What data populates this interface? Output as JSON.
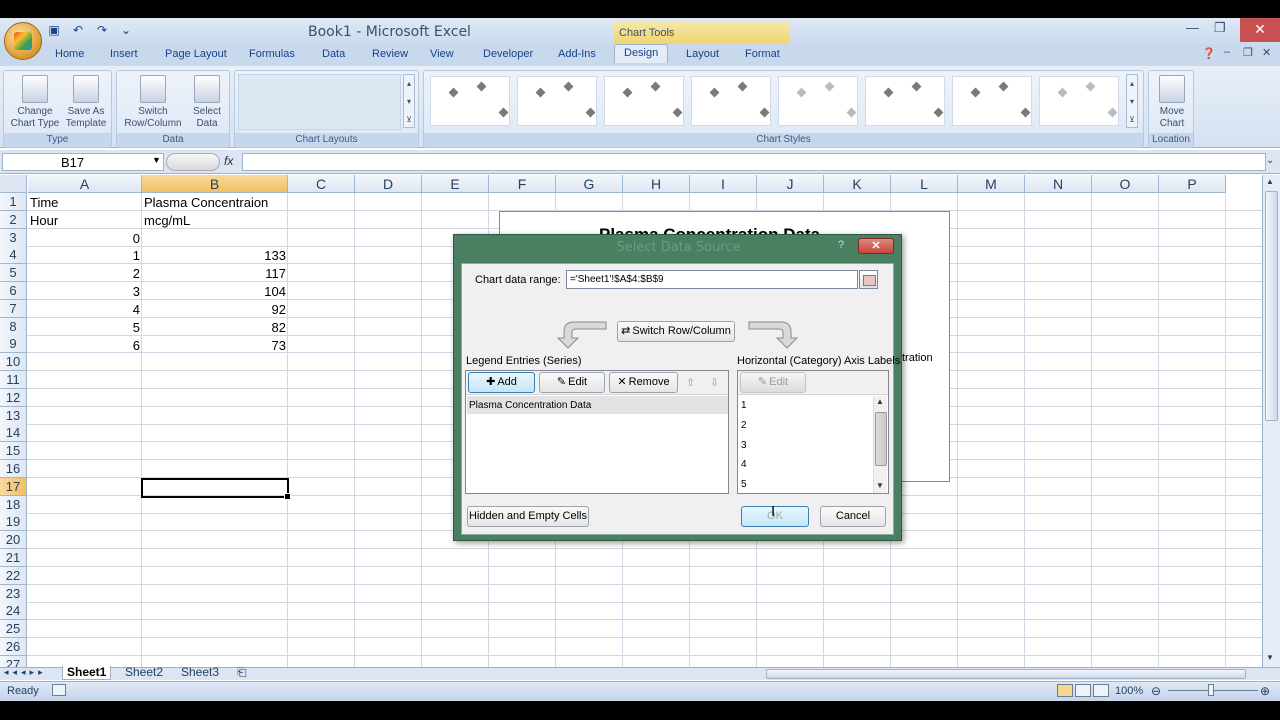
{
  "window": {
    "title": "Book1 - Microsoft Excel",
    "contextual_group": "Chart Tools"
  },
  "ribbon": {
    "tabs": [
      {
        "label": "Home"
      },
      {
        "label": "Insert"
      },
      {
        "label": "Page Layout"
      },
      {
        "label": "Formulas"
      },
      {
        "label": "Data"
      },
      {
        "label": "Review"
      },
      {
        "label": "View"
      },
      {
        "label": "Developer"
      },
      {
        "label": "Add-Ins"
      },
      {
        "label": "Design"
      },
      {
        "label": "Layout"
      },
      {
        "label": "Format"
      }
    ],
    "active_tab": "Design",
    "groups": {
      "type": {
        "label": "Type",
        "change_chart_type": "Change Chart Type",
        "save_as_template": "Save As Template"
      },
      "data": {
        "label": "Data",
        "switch_row_column": "Switch Row/Column",
        "select_data": "Select Data"
      },
      "chart_layouts": {
        "label": "Chart Layouts"
      },
      "chart_styles": {
        "label": "Chart Styles"
      },
      "location": {
        "label": "Location",
        "move_chart": "Move Chart"
      }
    }
  },
  "formula_bar": {
    "name_box": "B17",
    "fx": "fx",
    "formula": ""
  },
  "grid": {
    "columns": [
      "A",
      "B",
      "C",
      "D",
      "E",
      "F",
      "G",
      "H",
      "I",
      "J",
      "K",
      "L",
      "M",
      "N",
      "O",
      "P"
    ],
    "rows": [
      "1",
      "2",
      "3",
      "4",
      "5",
      "6",
      "7",
      "8",
      "9",
      "10",
      "11",
      "12",
      "13",
      "14",
      "15",
      "16",
      "17",
      "18",
      "19",
      "20",
      "21",
      "22",
      "23",
      "24",
      "25",
      "26",
      "27"
    ],
    "cells": {
      "A1": "Time",
      "B1": "Plasma Concentraion",
      "A2": "Hour",
      "B2": "mcg/mL",
      "A3": "0",
      "A4": "1",
      "B4": "133",
      "A5": "2",
      "B5": "117",
      "A6": "3",
      "B6": "104",
      "A7": "4",
      "B7": "92",
      "A8": "5",
      "B8": "82",
      "A9": "6",
      "B9": "73"
    },
    "selected_cell": "B17"
  },
  "chart": {
    "title": "Plasma Concentration Data",
    "legend_fragment": "tration"
  },
  "dialog": {
    "title": "Select Data Source",
    "help": "?",
    "close": "✕",
    "chart_data_range_label": "Chart data range:",
    "chart_data_range_value": "='Sheet1'!$A$4:$B$9",
    "switch_row_column": "Switch Row/Column",
    "legend_entries_label": "Legend Entries (Series)",
    "legend_buttons": {
      "add": "Add",
      "edit": "Edit",
      "remove": "Remove"
    },
    "series": [
      "Plasma Concentration Data"
    ],
    "axis_labels_label": "Horizontal (Category) Axis Labels",
    "axis_edit": "Edit",
    "axis_labels": [
      "1",
      "2",
      "3",
      "4",
      "5"
    ],
    "hidden_empty_cells": "Hidden and Empty Cells",
    "ok": "OK",
    "cancel": "Cancel"
  },
  "sheets": {
    "tabs": [
      "Sheet1",
      "Sheet2",
      "Sheet3"
    ],
    "active": "Sheet1"
  },
  "status": {
    "mode": "Ready",
    "zoom": "100%"
  }
}
